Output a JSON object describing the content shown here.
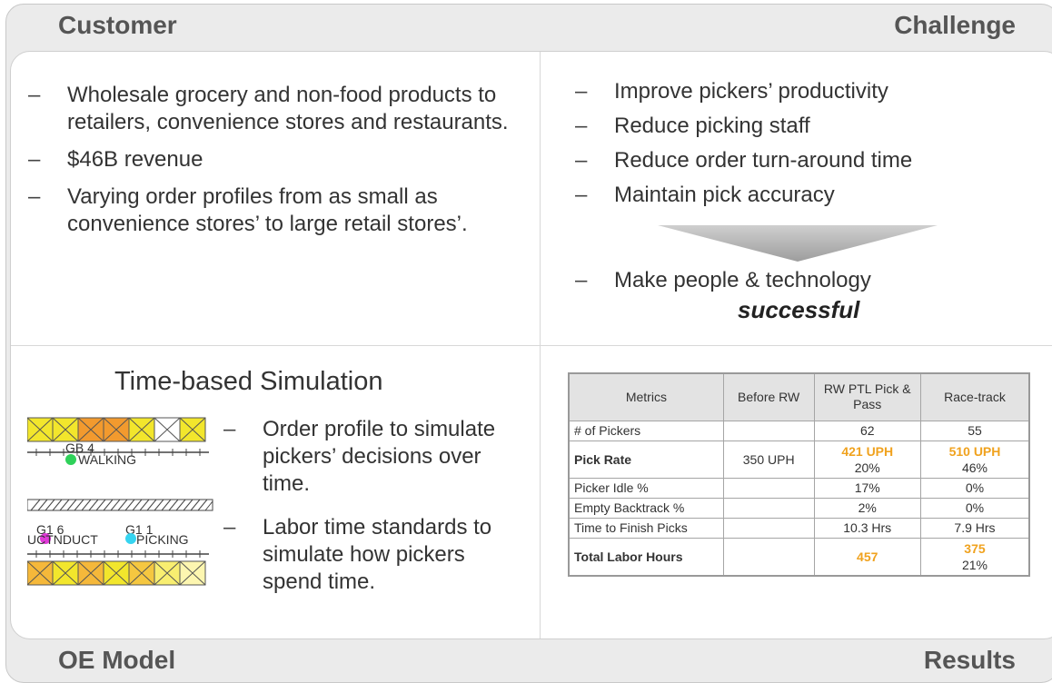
{
  "corners": {
    "customer": "Customer",
    "challenge": "Challenge",
    "oe_model": "OE Model",
    "results": "Results"
  },
  "customer_bullets": [
    "Wholesale grocery and non-food products to retailers, convenience stores and restaurants.",
    "$46B revenue",
    "Varying order profiles from as small as convenience stores’ to large retail stores’."
  ],
  "challenge_bullets": [
    "Improve pickers’ productivity",
    "Reduce picking staff",
    "Reduce order turn-around time",
    "Maintain pick accuracy"
  ],
  "challenge_result": {
    "text": "Make people & technology",
    "emphasis": "successful"
  },
  "oe_model": {
    "title": "Time-based Simulation",
    "bullets": [
      "Order profile to simulate pickers’ decisions over time.",
      "Labor time standards to simulate how pickers spend time."
    ],
    "sim_labels": {
      "gb4": "GB 4",
      "walking": "WALKING",
      "g1_6": "G1 6",
      "g1_1": "G1 1",
      "conduct": "UCTNDUCT",
      "picking": "PICKING"
    },
    "colors": {
      "yellow": "#f2e62c",
      "orange": "#f29a2e",
      "green": "#2fd15a",
      "magenta": "#e03ad8",
      "cyan": "#36d4f0",
      "pale": "#fdf6b0"
    }
  },
  "results": {
    "headers": [
      "Metrics",
      "Before RW",
      "RW PTL Pick & Pass",
      "Race-track"
    ],
    "rows": [
      {
        "metric": "# of Pickers",
        "before": "",
        "ptl": "62",
        "ptl_sub": "",
        "race": "55",
        "race_sub": ""
      },
      {
        "metric": "Pick Rate",
        "before": "350 UPH",
        "ptl": "421 UPH",
        "ptl_sub": "20%",
        "race": "510 UPH",
        "race_sub": "46%"
      },
      {
        "metric": "Picker Idle %",
        "before": "",
        "ptl": "17%",
        "ptl_sub": "",
        "race": "0%",
        "race_sub": ""
      },
      {
        "metric": "Empty Backtrack %",
        "before": "",
        "ptl": "2%",
        "ptl_sub": "",
        "race": "0%",
        "race_sub": ""
      },
      {
        "metric": "Time to Finish Picks",
        "before": "",
        "ptl": "10.3 Hrs",
        "ptl_sub": "",
        "race": "7.9 Hrs",
        "race_sub": ""
      },
      {
        "metric": "Total Labor Hours",
        "before": "",
        "ptl": "457",
        "ptl_sub": "",
        "race": "375",
        "race_sub": "21%"
      }
    ],
    "highlight_color": "#f0a21e"
  }
}
